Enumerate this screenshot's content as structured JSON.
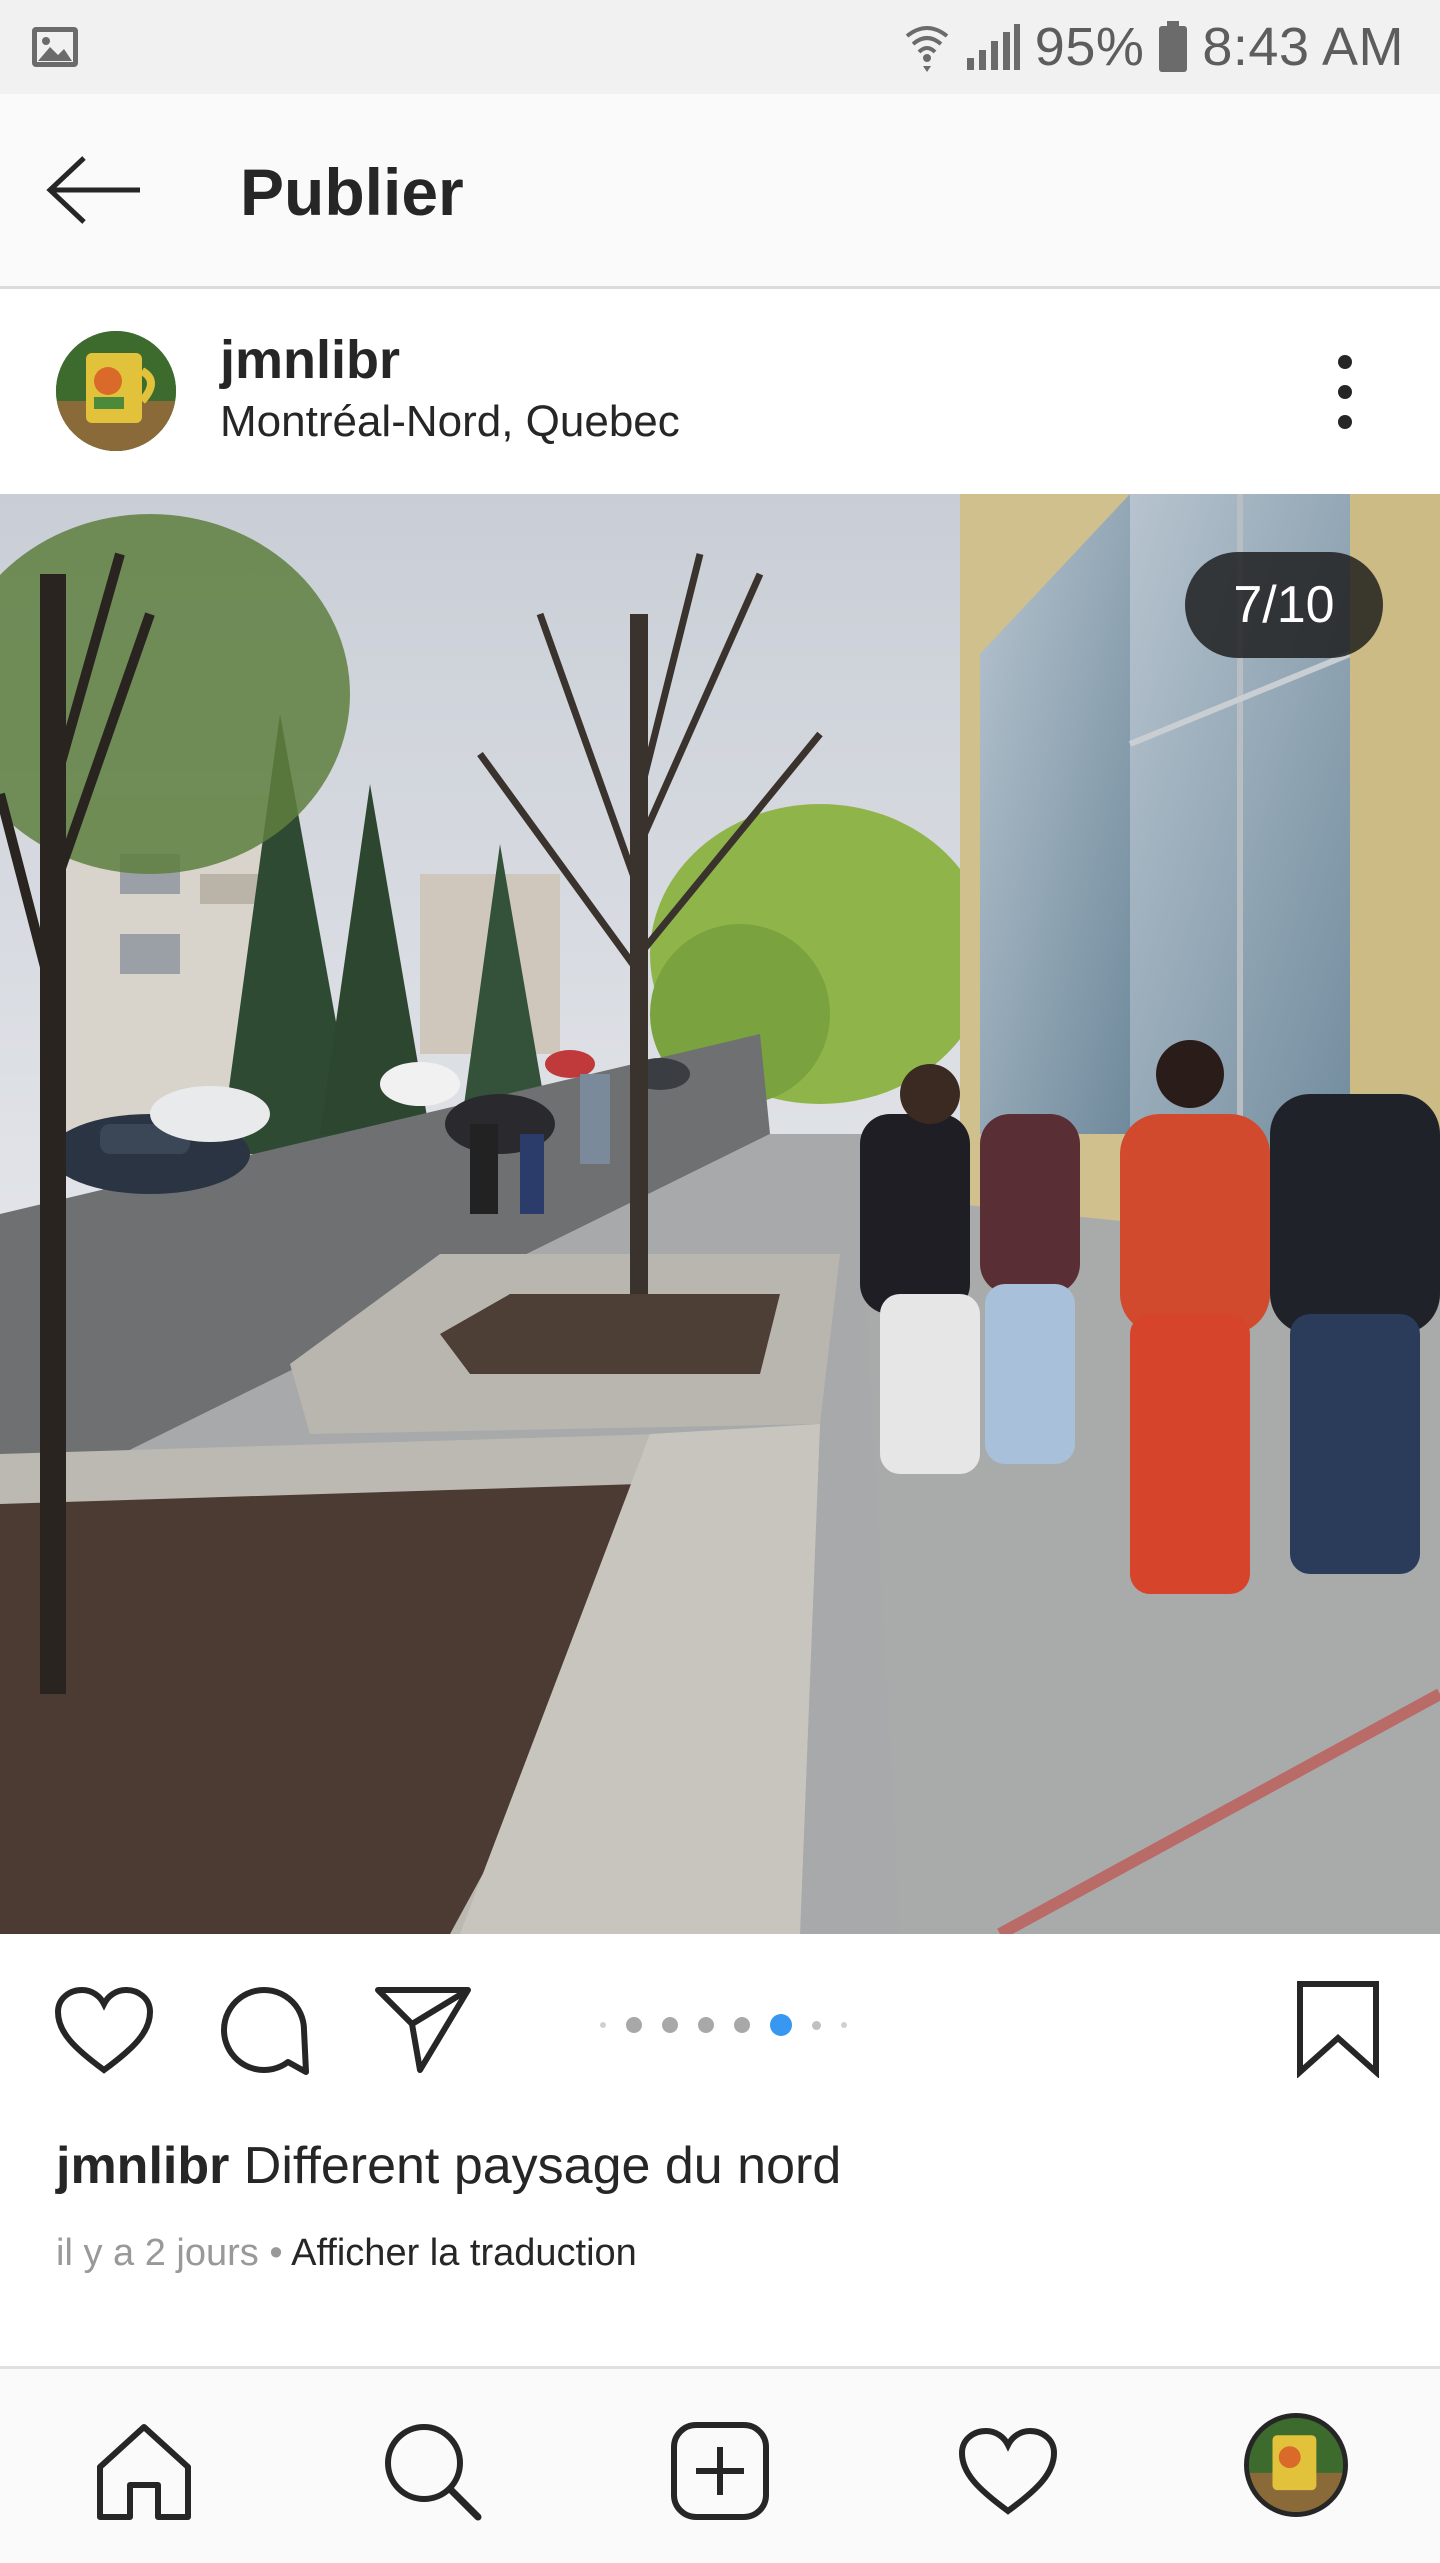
{
  "status_bar": {
    "battery": "95%",
    "time": "8:43 AM",
    "icons": [
      "gallery-icon",
      "wifi-icon",
      "signal-icon",
      "battery-icon"
    ]
  },
  "header": {
    "title": "Publier",
    "back_icon": "arrow-left-icon"
  },
  "post": {
    "username": "jmnlibr",
    "location": "Montréal-Nord, Quebec",
    "media_counter": "7/10",
    "carousel": {
      "total_visible_dots": 7,
      "active_index": 5
    },
    "caption_user": "jmnlibr",
    "caption_text": "Different paysage du nord",
    "time_ago": "il y a 2 jours",
    "separator": "•",
    "translate_label": "Afficher la traduction"
  },
  "actions": [
    "heart-icon",
    "comment-icon",
    "share-icon",
    "bookmark-icon"
  ],
  "bottom_nav": [
    "home-icon",
    "search-icon",
    "add-post-icon",
    "activity-heart-icon",
    "profile-avatar"
  ],
  "colors": {
    "accent": "#3897f0",
    "text": "#262626",
    "muted": "#999999",
    "status_bg": "#f1f1f1",
    "header_bg": "#fafafa"
  }
}
